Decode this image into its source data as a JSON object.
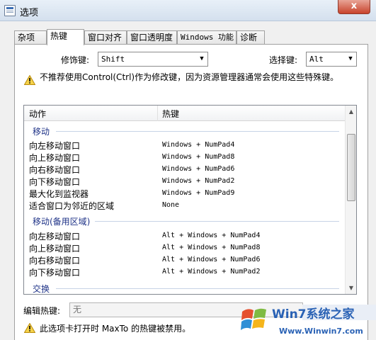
{
  "window": {
    "title": "选项",
    "close_glyph": "x"
  },
  "tabs": [
    {
      "label": "杂项",
      "active": false
    },
    {
      "label": "热键",
      "active": true
    },
    {
      "label": "窗口对齐",
      "active": false
    },
    {
      "label": "窗口透明度",
      "active": false
    },
    {
      "label": "Windows 功能",
      "active": false
    },
    {
      "label": "诊断",
      "active": false
    }
  ],
  "hotkeys": {
    "modifier_label": "修饰键:",
    "modifier_value": "Shift",
    "select_label": "选择键:",
    "select_value": "Alt",
    "warning": "不推荐使用Control(Ctrl)作为修改键，因为资源管理器通常会使用这些特殊键。"
  },
  "list": {
    "col_action": "动作",
    "col_hotkey": "热键",
    "groups": [
      {
        "name": "移动",
        "rows": [
          {
            "action": "向左移动窗口",
            "key": "Windows + NumPad4"
          },
          {
            "action": "向上移动窗口",
            "key": "Windows + NumPad8"
          },
          {
            "action": "向右移动窗口",
            "key": "Windows + NumPad6"
          },
          {
            "action": "向下移动窗口",
            "key": "Windows + NumPad2"
          },
          {
            "action": "最大化到监视器",
            "key": "Windows + NumPad9"
          },
          {
            "action": "适合窗口为邻近的区域",
            "key": "None"
          }
        ]
      },
      {
        "name": "移动(备用区域)",
        "rows": [
          {
            "action": "向左移动窗口",
            "key": "Alt + Windows + NumPad4"
          },
          {
            "action": "向上移动窗口",
            "key": "Alt + Windows + NumPad8"
          },
          {
            "action": "向右移动窗口",
            "key": "Alt + Windows + NumPad6"
          },
          {
            "action": "向下移动窗口",
            "key": "Alt + Windows + NumPad2"
          }
        ]
      },
      {
        "name": "交换",
        "rows": []
      }
    ]
  },
  "edit": {
    "label": "编辑热键:",
    "value": "无",
    "warning": "此选项卡打开时 MaxTo 的热键被禁用。"
  },
  "watermark": {
    "brand": "Win7系统之家",
    "url": "Www.Winwin7.com"
  }
}
